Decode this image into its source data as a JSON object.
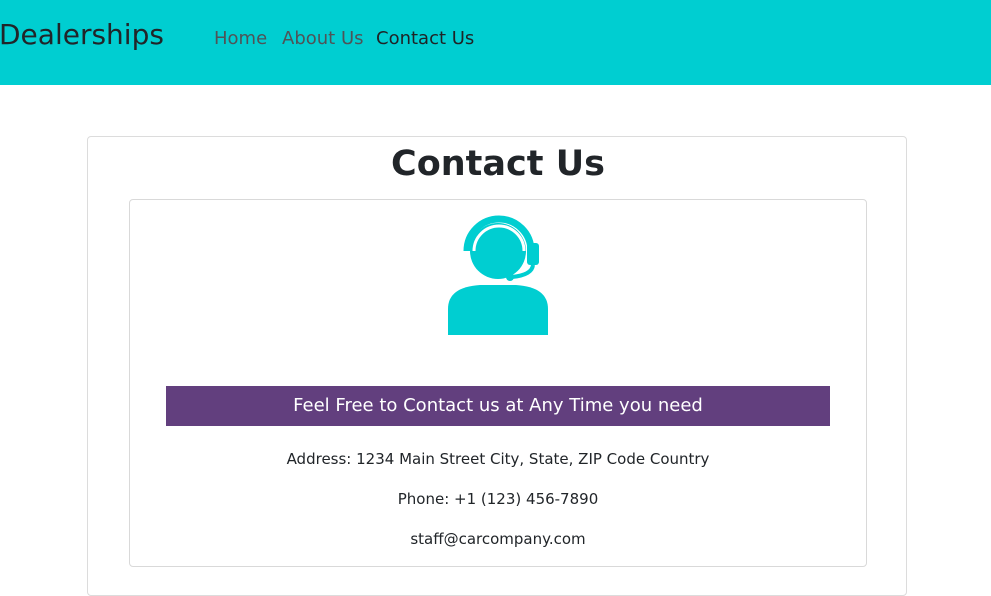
{
  "navbar": {
    "brand": "Dealerships",
    "links": [
      {
        "label": "Home",
        "active": false
      },
      {
        "label": "About Us",
        "active": false
      },
      {
        "label": "Contact Us",
        "active": true
      }
    ],
    "background_color": "#00ced1"
  },
  "main": {
    "title": "Contact Us",
    "icon": "customer-support-headset-icon",
    "icon_color": "#00ced1",
    "banner": {
      "text": "Feel Free to Contact us at Any Time you need",
      "background_color": "#623f7e"
    },
    "contact": {
      "address": "Address: 1234 Main Street City, State, ZIP Code Country",
      "phone": "Phone: +1 (123) 456-7890",
      "email": "staff@carcompany.com"
    }
  }
}
